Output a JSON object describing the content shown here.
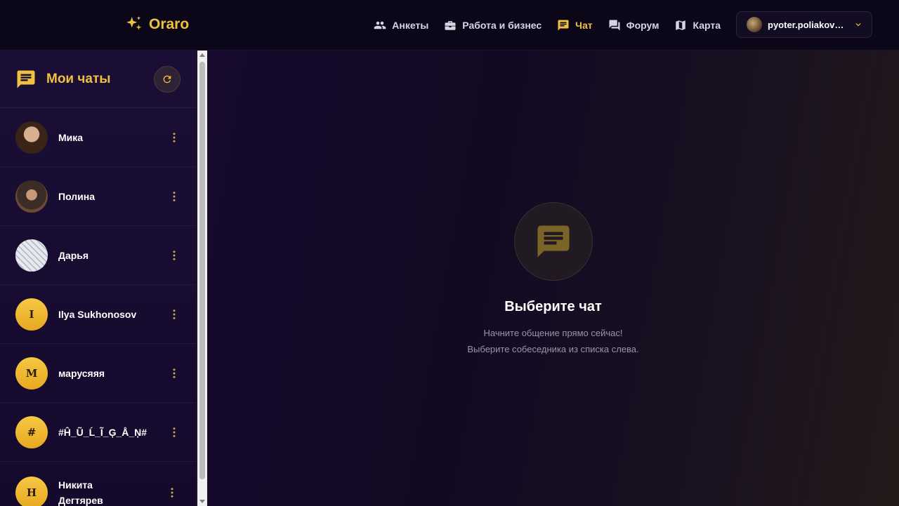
{
  "brand": {
    "name": "Oraro",
    "icon": "sparkle-icon",
    "color": "#f0c040"
  },
  "nav": [
    {
      "label": "Анкеты",
      "icon": "people-icon",
      "active": false
    },
    {
      "label": "Работа и бизнес",
      "icon": "briefcase-icon",
      "active": false
    },
    {
      "label": "Чат",
      "icon": "chat-icon",
      "active": true
    },
    {
      "label": "Форум",
      "icon": "forum-icon",
      "active": false
    },
    {
      "label": "Карта",
      "icon": "map-icon",
      "active": false
    }
  ],
  "user": {
    "name": "pyoter.poliakov@..."
  },
  "sidebar": {
    "title": "Мои чаты",
    "chats": [
      {
        "name": "Мика",
        "avatar": "photo"
      },
      {
        "name": "Полина",
        "avatar": "photo"
      },
      {
        "name": "Дарья",
        "avatar": "photo"
      },
      {
        "name": "Ilya Sukhonosov",
        "avatar": "I"
      },
      {
        "name": "марусяяя",
        "avatar": "M"
      },
      {
        "name": "#Ĥ_Ũ_Ĺ_Ĩ_Ģ_Å_Ņ#",
        "avatar": "#"
      },
      {
        "name": "Никита Дегтярев",
        "avatar": "H"
      }
    ]
  },
  "main": {
    "empty_title": "Выберите чат",
    "empty_line1": "Начните общение прямо сейчас!",
    "empty_line2": "Выберите собеседника из списка слева."
  }
}
